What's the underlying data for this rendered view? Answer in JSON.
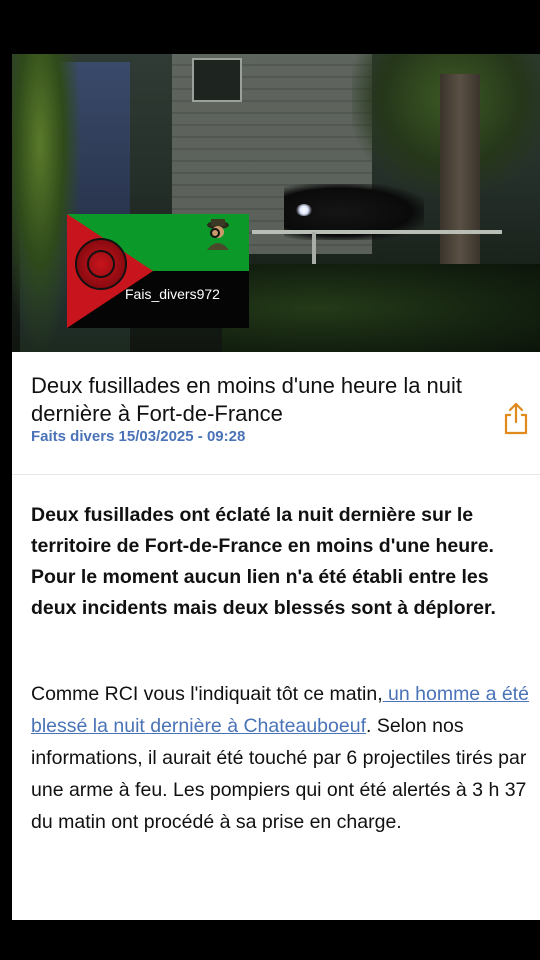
{
  "hero": {
    "watermark": {
      "handle": "Fais_divers972"
    }
  },
  "article": {
    "title": "Deux fusillades en moins d'une heure la nuit dernière à Fort-de-France",
    "category": "Faits divers",
    "date": "15/03/2025 - 09:28",
    "lead": "Deux fusillades ont éclaté la nuit dernière sur le territoire de Fort-de-France en moins d'une heure. Pour le moment aucun lien n'a été établi entre les deux incidents mais deux blessés sont à déplorer.",
    "body": {
      "before_link": "Comme RCI vous l'indiquait tôt ce matin,",
      "link_text": " un homme a été blessé la nuit dernière à Chateauboeuf",
      "after_link": ". Selon nos informations, il aurait été touché par 6 projectiles tirés par une arme à feu. Les pompiers qui ont été alertés à 3 h 37 du matin ont procédé à sa prise en charge."
    }
  },
  "icons": {
    "share": "share-icon"
  },
  "colors": {
    "accent": "#4a73b8",
    "flag_green": "#0b9a2a",
    "flag_red": "#c8141c",
    "flag_black": "#050505"
  }
}
